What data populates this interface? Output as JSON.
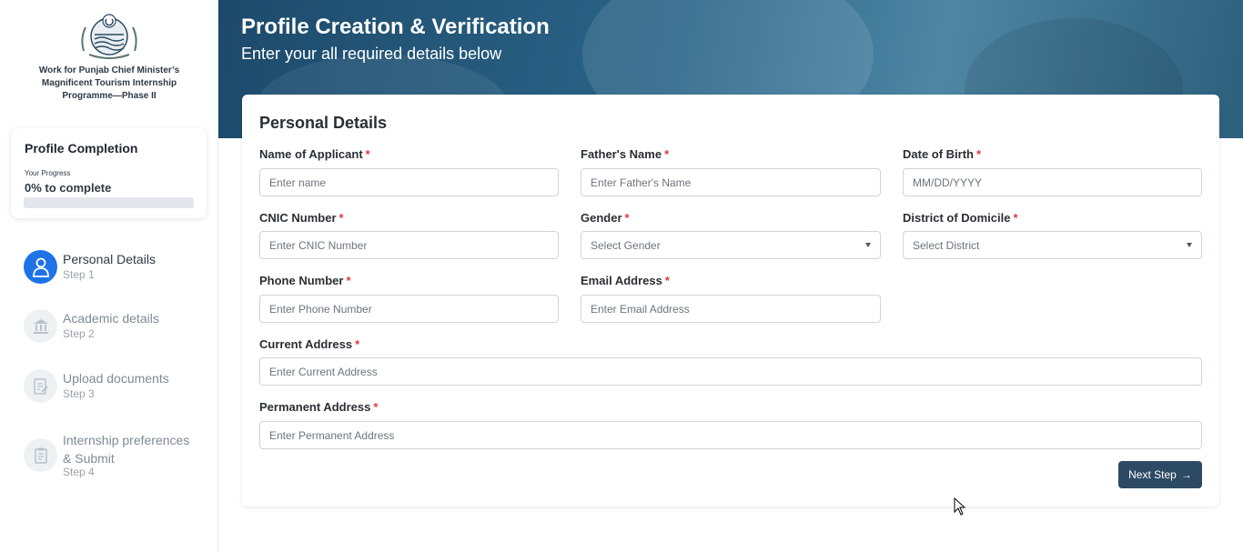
{
  "sidebar": {
    "org_name": "Work for Punjab Chief Minister’s Magnificent Tourism Internship Programme—Phase II",
    "progress": {
      "title": "Profile Completion",
      "subtitle": "Your Progress",
      "value_text": "0% to complete",
      "fraction": 0
    },
    "steps": [
      {
        "label": "Personal Details",
        "step": "Step 1",
        "icon": "user-icon",
        "active": true
      },
      {
        "label": "Academic details",
        "step": "Step 2",
        "icon": "institution-icon",
        "active": false
      },
      {
        "label": "Upload documents",
        "step": "Step 3",
        "icon": "document-edit-icon",
        "active": false
      },
      {
        "label": "Internship preferences & Submit",
        "step": "Step 4",
        "icon": "clipboard-icon",
        "active": false
      }
    ]
  },
  "header": {
    "title": "Profile Creation & Verification",
    "subtitle": "Enter your all required details below"
  },
  "form": {
    "title": "Personal Details",
    "required_mark": "*",
    "fields": {
      "name": {
        "label": "Name of Applicant",
        "placeholder": "Enter name"
      },
      "father": {
        "label": "Father's Name",
        "placeholder": "Enter Father's Name"
      },
      "dob": {
        "label": "Date of Birth",
        "placeholder": "MM/DD/YYYY"
      },
      "cnic": {
        "label": "CNIC Number",
        "placeholder": "Enter CNIC Number"
      },
      "gender": {
        "label": "Gender",
        "placeholder": "Select Gender"
      },
      "district": {
        "label": "District of Domicile",
        "placeholder": "Select District"
      },
      "phone": {
        "label": "Phone Number",
        "placeholder": "Enter Phone Number"
      },
      "email": {
        "label": "Email Address",
        "placeholder": "Enter Email Address"
      },
      "current_address": {
        "label": "Current Address",
        "placeholder": "Enter Current Address"
      },
      "permanent_address": {
        "label": "Permanent Address",
        "placeholder": "Enter Permanent Address"
      }
    },
    "next_button": "Next Step",
    "next_arrow": "→"
  },
  "colors": {
    "accent": "#1e73e8",
    "primary_button": "#2c4a63",
    "header_bg": "#2b6588",
    "required": "#e03b3b"
  }
}
